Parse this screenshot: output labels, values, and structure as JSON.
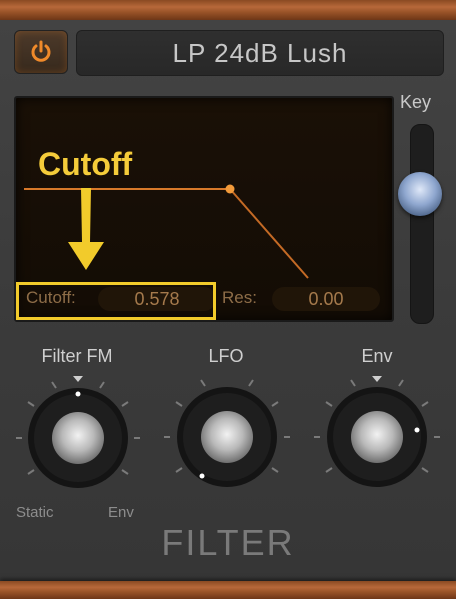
{
  "preset": {
    "name": "LP 24dB Lush"
  },
  "annotation": {
    "label": "Cutoff",
    "color": "#f2cb2b"
  },
  "params": {
    "cutoff_label": "Cutoff:",
    "cutoff_value": "0.578",
    "res_label": "Res:",
    "res_value": "0.00"
  },
  "key": {
    "label": "Key"
  },
  "knobs": {
    "filter_fm": {
      "label": "Filter FM",
      "min_label": "Static",
      "max_label": "Env"
    },
    "lfo": {
      "label": "LFO"
    },
    "env": {
      "label": "Env"
    }
  },
  "section": {
    "title": "FILTER"
  },
  "colors": {
    "accent": "#f08a2a",
    "curve": "#e07a2a",
    "display_text": "#a57a4c"
  },
  "icons": {
    "power": "power-icon",
    "arrow": "arrow-down-icon"
  }
}
